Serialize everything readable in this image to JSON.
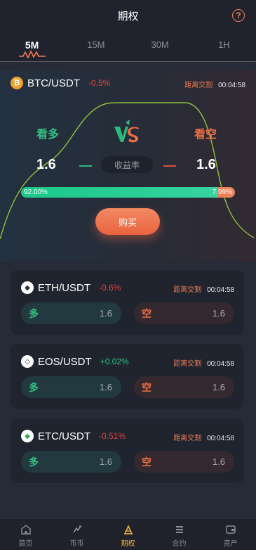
{
  "header": {
    "title": "期权",
    "help_icon": "question-circle-icon"
  },
  "tabs": [
    {
      "label": "5M",
      "active": true
    },
    {
      "label": "15M",
      "active": false
    },
    {
      "label": "30M",
      "active": false
    },
    {
      "label": "1H",
      "active": false
    }
  ],
  "featured": {
    "pair": "BTC/USDT",
    "change": "-0.5%",
    "countdown_label": "距离交割",
    "countdown": "00:04:58",
    "up_label": "看多",
    "down_label": "看空",
    "up_rate": "1.6",
    "down_rate": "1.6",
    "yield_label": "收益率",
    "up_ratio_text": "92.00%",
    "down_ratio_text": "7.99%",
    "up_ratio": 0.92,
    "buy_label": "购买"
  },
  "cards": [
    {
      "pair": "ETH/USDT",
      "change": "-0.6%",
      "countdown_label": "距离交割",
      "countdown": "00:04:58",
      "long_label": "多",
      "long_rate": "1.6",
      "short_label": "空",
      "short_rate": "1.6"
    },
    {
      "pair": "EOS/USDT",
      "change": "+0.02%",
      "countdown_label": "距离交割",
      "countdown": "00:04:58",
      "long_label": "多",
      "long_rate": "1.6",
      "short_label": "空",
      "short_rate": "1.6"
    },
    {
      "pair": "ETC/USDT",
      "change": "-0.51%",
      "countdown_label": "距离交割",
      "countdown": "00:04:58",
      "long_label": "多",
      "long_rate": "1.6",
      "short_label": "空",
      "short_rate": "1.6"
    }
  ],
  "nav": [
    {
      "label": "首页",
      "icon": "home-icon",
      "active": false
    },
    {
      "label": "币币",
      "icon": "exchange-icon",
      "active": false
    },
    {
      "label": "期权",
      "icon": "options-icon",
      "active": true
    },
    {
      "label": "合约",
      "icon": "contract-icon",
      "active": false
    },
    {
      "label": "资产",
      "icon": "wallet-icon",
      "active": false
    }
  ],
  "colors": {
    "accent": "#ef7b55",
    "up": "#33c182",
    "down": "#ef6f47",
    "nav_active": "#f2b13b"
  }
}
